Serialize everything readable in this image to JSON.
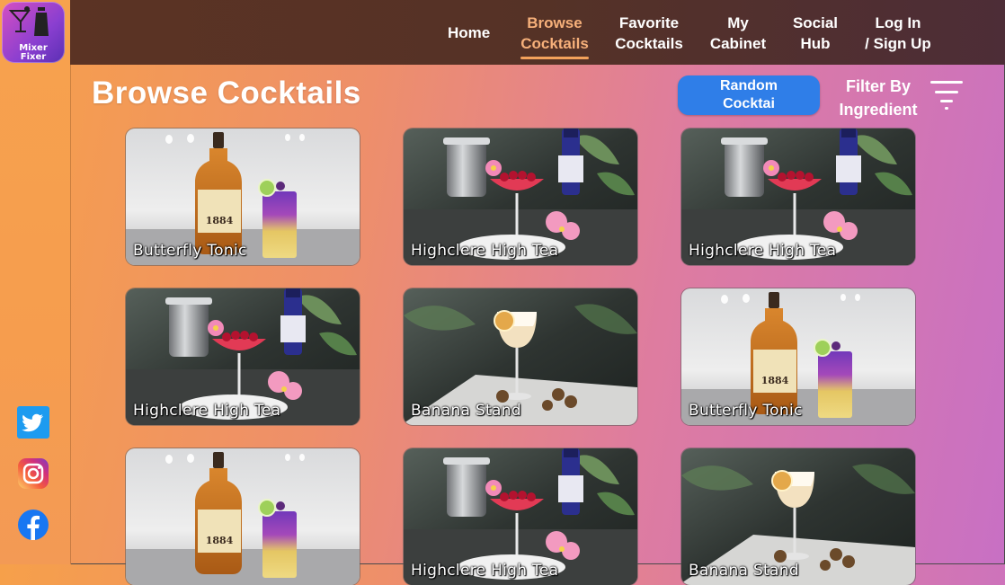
{
  "app": {
    "logo_line1": "Mixer",
    "logo_line2": "Fixer"
  },
  "nav": {
    "home": "Home",
    "browse_line1": "Browse",
    "browse_line2": "Cocktails",
    "favorite_line1": "Favorite",
    "favorite_line2": "Cocktails",
    "cabinet_line1": "My",
    "cabinet_line2": "Cabinet",
    "social_line1": "Social",
    "social_line2": "Hub",
    "login_line1": "Log In",
    "login_line2": "/ Sign Up"
  },
  "page": {
    "title": "Browse Cocktails",
    "random_line1": "Random",
    "random_line2": "Cocktai",
    "filter_line1": "Filter By",
    "filter_line2": "Ingredient"
  },
  "cocktails": [
    {
      "name": "Butterfly Tonic",
      "photo": "butterfly"
    },
    {
      "name": "Highclere High Tea",
      "photo": "hightea"
    },
    {
      "name": "Highclere High Tea",
      "photo": "hightea"
    },
    {
      "name": "Highclere High Tea",
      "photo": "hightea"
    },
    {
      "name": "Banana Stand",
      "photo": "banana"
    },
    {
      "name": "Butterfly Tonic",
      "photo": "butterfly"
    },
    {
      "name": "",
      "photo": "butterfly"
    },
    {
      "name": "Highclere High Tea",
      "photo": "hightea"
    },
    {
      "name": "Banana Stand",
      "photo": "banana"
    }
  ],
  "social": [
    "twitter-icon",
    "instagram-icon",
    "facebook-icon"
  ],
  "colors": {
    "header": "#553226",
    "accent": "#f3a25b",
    "button": "#2f7ee8"
  }
}
